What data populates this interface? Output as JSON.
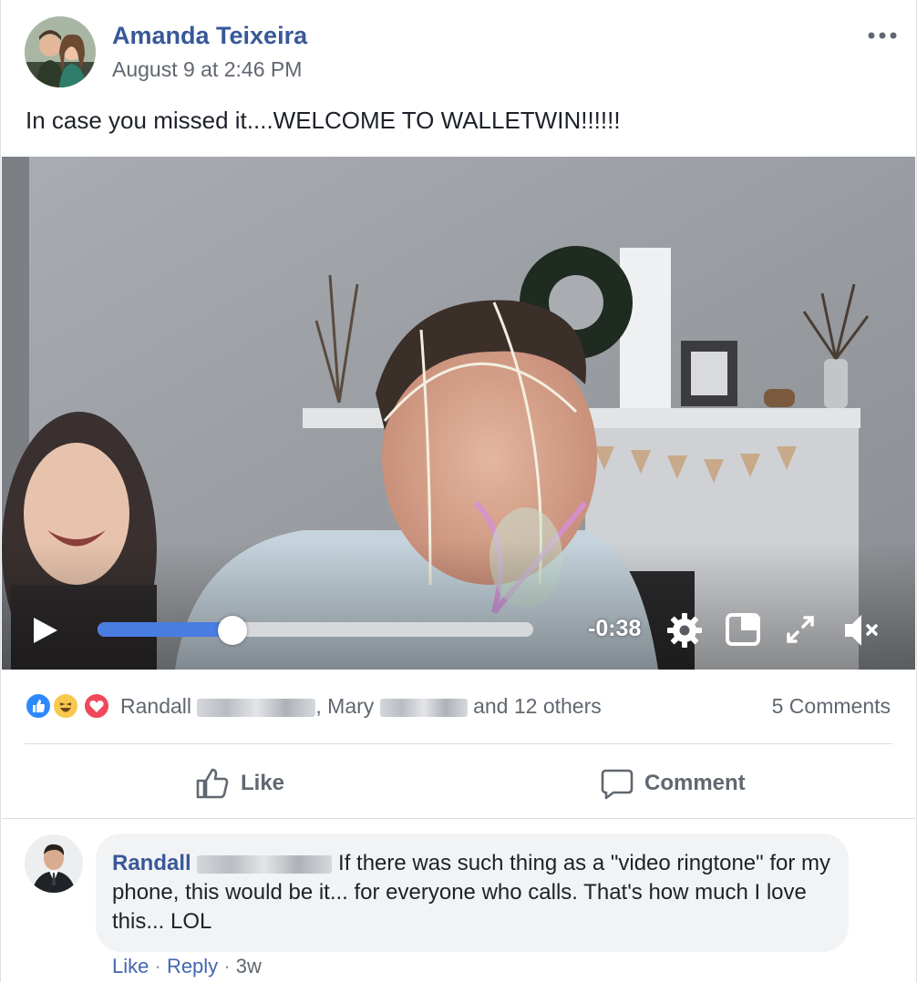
{
  "post": {
    "author": "Amanda Teixeira",
    "timestamp": "August 9 at 2:46 PM",
    "message": "In case you missed it....WELCOME TO WALLETWIN!!!!!!",
    "more_icon": "more-options-icon"
  },
  "video": {
    "time_remaining": "-0:38",
    "progress": 0.31,
    "controls": [
      "play-icon",
      "settings-icon",
      "picture-in-picture-icon",
      "fullscreen-icon",
      "mute-icon"
    ]
  },
  "reactions": {
    "types": [
      "like",
      "haha",
      "love"
    ],
    "name1": "Randall",
    "separator": ", ",
    "name2": "Mary",
    "others": "and 12 others",
    "comments_count": "5 Comments"
  },
  "actions": {
    "like_label": "Like",
    "comment_label": "Comment"
  },
  "comment": {
    "author": "Randall",
    "text": "If there was such thing as a \"video ringtone\" for my phone, this would be it... for everyone who calls. That's how much I love this... LOL",
    "like_label": "Like",
    "dot": "·",
    "reply_label": "Reply",
    "age": "3w"
  },
  "colors": {
    "link_blue": "#385898",
    "like_blue": "#2e89ff",
    "progress_blue": "#4a7de2",
    "love_red": "#f0485a",
    "haha_yellow": "#f7c84d",
    "bubble_gray": "#f2f3f5"
  }
}
